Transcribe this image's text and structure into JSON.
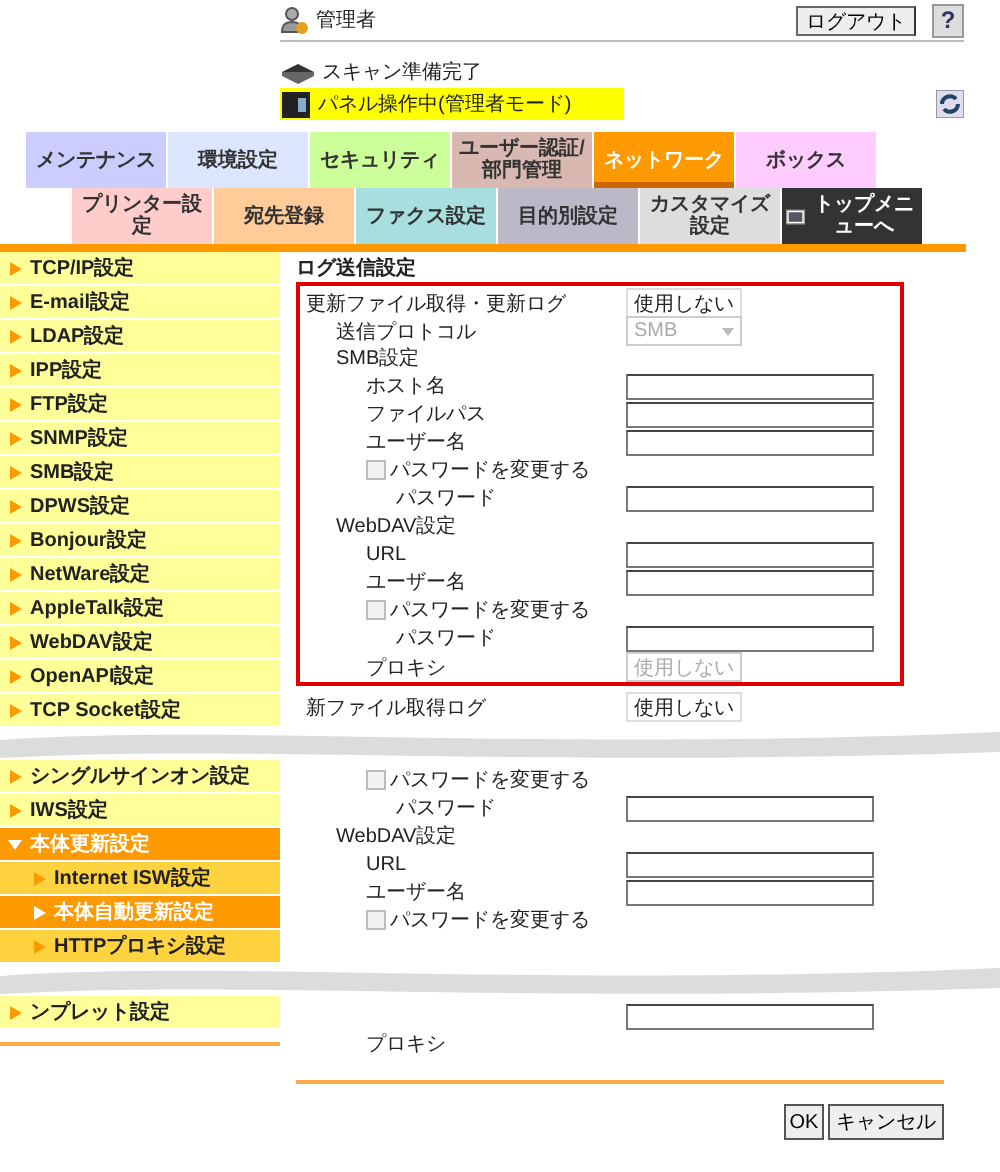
{
  "header": {
    "user": "管理者",
    "logout": "ログアウト",
    "help": "?",
    "status": "スキャン準備完了",
    "panel_status": "パネル操作中(管理者モード)"
  },
  "tabs": [
    {
      "label": "メンテナンス",
      "color": "#ccccff",
      "selected": false
    },
    {
      "label": "環境設定",
      "color": "#dde6ff",
      "selected": false
    },
    {
      "label": "セキュリティ",
      "color": "#ccff99",
      "selected": false
    },
    {
      "label": "ユーザー認証/部門管理",
      "color": "#d8b8b0",
      "selected": false
    },
    {
      "label": "ネットワーク",
      "color": "#ff9900",
      "selected": true
    },
    {
      "label": "ボックス",
      "color": "#ffccff",
      "selected": false
    }
  ],
  "subtabs": [
    {
      "kind": "tab",
      "label": "プリンター設定",
      "color": "#ffcccc",
      "selected": false
    },
    {
      "kind": "tab",
      "label": "宛先登録",
      "color": "#ffcc99",
      "selected": false
    },
    {
      "kind": "tab",
      "label": "ファクス設定",
      "color": "#a8dede",
      "selected": false
    },
    {
      "kind": "tab",
      "label": "目的別設定",
      "color": "#bcb8c8",
      "selected": false
    },
    {
      "kind": "tab",
      "label": "カスタマイズ設定",
      "color": "#dddddd",
      "selected": false
    },
    {
      "kind": "home",
      "label": "トップメニューへ",
      "color": "#333333",
      "selected": false
    }
  ],
  "page_title": "ログ送信設定",
  "sections": [
    {
      "sidebar": [
        {
          "label": "TCP/IP設定",
          "selected": false,
          "expanded": false
        },
        {
          "label": "E-mail設定",
          "selected": false,
          "expanded": false
        },
        {
          "label": "LDAP設定",
          "selected": false,
          "expanded": false
        },
        {
          "label": "IPP設定",
          "selected": false,
          "expanded": false
        },
        {
          "label": "FTP設定",
          "selected": false,
          "expanded": false
        },
        {
          "label": "SNMP設定",
          "selected": false,
          "expanded": false
        },
        {
          "label": "SMB設定",
          "selected": false,
          "expanded": false
        },
        {
          "label": "DPWS設定",
          "selected": false,
          "expanded": false
        },
        {
          "label": "Bonjour設定",
          "selected": false,
          "expanded": false
        },
        {
          "label": "NetWare設定",
          "selected": false,
          "expanded": false
        },
        {
          "label": "AppleTalk設定",
          "selected": false,
          "expanded": false
        },
        {
          "label": "WebDAV設定",
          "selected": false,
          "expanded": false
        },
        {
          "label": "OpenAPI設定",
          "selected": false,
          "expanded": false
        },
        {
          "label": "TCP Socket設定",
          "selected": false,
          "expanded": false
        }
      ],
      "blocks": [
        {
          "highlighted": true,
          "rows": [
            {
              "kind": "select",
              "label": "更新ファイル取得・更新ログ",
              "value": "使用しない",
              "disabled": false,
              "children": [
                {
                  "kind": "select",
                  "label": "送信プロトコル",
                  "value": "SMB",
                  "disabled": true
                },
                {
                  "kind": "heading",
                  "label": "SMB設定",
                  "children": [
                    {
                      "kind": "text",
                      "label": "ホスト名"
                    },
                    {
                      "kind": "text",
                      "label": "ファイルパス"
                    },
                    {
                      "kind": "text",
                      "label": "ユーザー名"
                    },
                    {
                      "kind": "checkbox",
                      "label": "パスワードを変更する",
                      "checked": false,
                      "disabled": true,
                      "children": [
                        {
                          "kind": "text",
                          "label": "パスワード"
                        }
                      ]
                    }
                  ]
                },
                {
                  "kind": "heading",
                  "label": "WebDAV設定",
                  "children": [
                    {
                      "kind": "text",
                      "label": "URL"
                    },
                    {
                      "kind": "text",
                      "label": "ユーザー名"
                    },
                    {
                      "kind": "checkbox",
                      "label": "パスワードを変更する",
                      "checked": false,
                      "disabled": true,
                      "children": [
                        {
                          "kind": "text",
                          "label": "パスワード"
                        }
                      ]
                    },
                    {
                      "kind": "select",
                      "label": "プロキシ",
                      "value": "使用しない",
                      "disabled": true
                    }
                  ]
                }
              ]
            }
          ]
        },
        {
          "highlighted": false,
          "rows": [
            {
              "kind": "select",
              "label": "新ファイル取得ログ",
              "value": "使用しない",
              "disabled": false
            }
          ]
        }
      ]
    },
    {
      "sidebar": [
        {
          "label": "シングルサインオン設定",
          "selected": false,
          "expanded": false
        },
        {
          "label": "IWS設定",
          "selected": false,
          "expanded": false
        },
        {
          "label": "本体更新設定",
          "selected": true,
          "expanded": true,
          "children": [
            {
              "label": "Internet ISW設定",
              "selected": false
            },
            {
              "label": "本体自動更新設定",
              "selected": true
            },
            {
              "label": "HTTPプロキシ設定",
              "selected": false
            }
          ]
        }
      ],
      "blocks": [
        {
          "highlighted": false,
          "rows": [
            {
              "kind": "group",
              "children": [
                {
                  "kind": "group",
                  "children": [
                    {
                      "kind": "checkbox",
                      "label": "パスワードを変更する",
                      "checked": false,
                      "disabled": true,
                      "children": [
                        {
                          "kind": "text",
                          "label": "パスワード"
                        }
                      ]
                    }
                  ]
                },
                {
                  "kind": "heading",
                  "label": "WebDAV設定",
                  "children": [
                    {
                      "kind": "text",
                      "label": "URL"
                    },
                    {
                      "kind": "text",
                      "label": "ユーザー名"
                    },
                    {
                      "kind": "checkbox",
                      "label": "パスワードを変更する",
                      "checked": false,
                      "disabled": true
                    }
                  ]
                }
              ]
            }
          ]
        }
      ]
    },
    {
      "sidebar": [
        {
          "label": "ンプレット設定",
          "selected": false,
          "expanded": false
        }
      ],
      "blocks": [
        {
          "highlighted": false,
          "rows": [
            {
              "kind": "group",
              "children": [
                {
                  "kind": "group",
                  "children": [
                    {
                      "kind": "group",
                      "children": [
                        {
                          "kind": "text"
                        }
                      ]
                    },
                    {
                      "kind": "label",
                      "label": "プロキシ"
                    }
                  ]
                }
              ]
            }
          ]
        }
      ]
    }
  ],
  "buttons": [
    "OK",
    "キャンセル"
  ]
}
